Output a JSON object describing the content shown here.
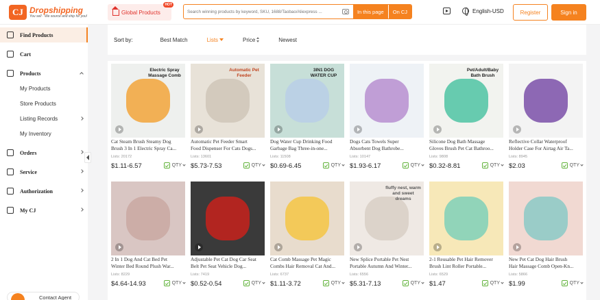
{
  "header": {
    "logo_mark": "CJ",
    "logo_name": "Dropshipping",
    "logo_tagline": "You sell · We source and ship for you!",
    "global_products": "Global Products",
    "hot_badge": "HOT",
    "search_placeholder": "Search winning products by keyword, SKU, 1688/Taobao/Aliexpress ...",
    "search_in_page": "In this page",
    "search_on_cj": "On CJ",
    "language": "English-USD",
    "register": "Register",
    "sign_in": "Sign in"
  },
  "sidebar": {
    "items": [
      {
        "label": "Find Products",
        "icon": "search-icon"
      },
      {
        "label": "Cart",
        "icon": "cart-icon"
      },
      {
        "label": "Products",
        "icon": "box-icon"
      },
      {
        "label": "Orders",
        "icon": "orders-icon"
      },
      {
        "label": "Service",
        "icon": "service-icon"
      },
      {
        "label": "Authorization",
        "icon": "authorization-icon"
      },
      {
        "label": "My CJ",
        "icon": "user-icon"
      }
    ],
    "products_sub": [
      "My Products",
      "Store Products",
      "Listing Records",
      "My Inventory"
    ],
    "contact_agent": "Contact Agent"
  },
  "sortbar": {
    "label": "Sort by:",
    "options": [
      "Best Match",
      "Lists",
      "Price",
      "Newest"
    ],
    "active": "Lists"
  },
  "products": [
    {
      "line1": "Cat Steam Brush Steamy Dog",
      "line2": "Brush 3 In 1 Electric Spray Ca...",
      "lists": "Lists: 20172",
      "price": "$1.11-6.57",
      "qty": "QTY",
      "bg": "#eef0ee",
      "accent": "#f2a43a",
      "overlay": "Electric Spray Massage Comb"
    },
    {
      "line1": "Automatic Pet Feeder Smart",
      "line2": "Food Dispenser For Cats Dogs...",
      "lists": "Lists: 13601",
      "price": "$5.73-7.53",
      "qty": "QTY",
      "bg": "#e8e2d8",
      "accent": "#cfc6b8",
      "overlay": "Automatic Pet Feeder"
    },
    {
      "line1": "Dog Water Cup Drinking Food",
      "line2": "Garbage Bag Three-in-one...",
      "lists": "Lists: 11508",
      "price": "$0.69-6.45",
      "qty": "QTY",
      "bg": "#c7dfd8",
      "accent": "#b9cfe8",
      "overlay": "3IN1 DOG WATER CUP"
    },
    {
      "line1": "Dogs Cats Towels Super",
      "line2": "Absorbent Dog Bathrobe...",
      "lists": "Lists: 10147",
      "price": "$1.93-6.17",
      "qty": "QTY",
      "bg": "#eef2f6",
      "accent": "#b78fd0",
      "overlay": ""
    },
    {
      "line1": "Silicone Dog Bath Massage",
      "line2": "Gloves Brush Pet Cat Bathroo...",
      "lists": "Lists: 9808",
      "price": "$0.32-8.81",
      "qty": "QTY",
      "bg": "#f2f3ef",
      "accent": "#4fc3a3",
      "overlay": "Pet/Adult/Baby Bath Brush"
    },
    {
      "line1": "Reflective Collar Waterproof",
      "line2": "Holder Case For Airtag Air Ta...",
      "lists": "Lists: 8945",
      "price": "$2.03",
      "qty": "QTY",
      "bg": "#f3f3f3",
      "accent": "#7a4fa8",
      "overlay": ""
    },
    {
      "line1": "2 In 1 Dog And Cat Bed Pet",
      "line2": "Winter Bed Round Plush War...",
      "lists": "Lists: 8229",
      "price": "$4.64-14.93",
      "qty": "QTY",
      "bg": "#d9c6c3",
      "accent": "#c9a8a2",
      "overlay": ""
    },
    {
      "line1": "Adjustable Pet Cat Dog Car Seat",
      "line2": "Belt Pet Seat Vehicle Dog...",
      "lists": "Lists: 7419",
      "price": "$0.52-0.54",
      "qty": "QTY",
      "bg": "#3a3a3a",
      "accent": "#c8221c",
      "overlay": ""
    },
    {
      "line1": "Cat Comb Massage Pet Magic",
      "line2": "Combs Hair Removal Cat And...",
      "lists": "Lists: 6737",
      "price": "$1.11-3.72",
      "qty": "QTY",
      "bg": "#e8dccd",
      "accent": "#f5c544",
      "overlay": ""
    },
    {
      "line1": "New Splice Portable Pet Nest",
      "line2": "Portable Autumn And Winter...",
      "lists": "Lists: 6556",
      "price": "$5.31-7.13",
      "qty": "QTY",
      "bg": "#efe9e4",
      "accent": "#d8cfc6",
      "overlay": "fluffy nest, warm and sweet dreams"
    },
    {
      "line1": "2-1 Reusable Pet Hair Remover",
      "line2": "Brush Lint Roller Portable...",
      "lists": "Lists: 6529",
      "price": "$1.47",
      "qty": "QTY",
      "bg": "#f7e8b8",
      "accent": "#7fd0b8",
      "overlay": ""
    },
    {
      "line1": "New Pet Cat Dog Hair Brush",
      "line2": "Hair Massage Comb Open-Kn...",
      "lists": "Lists: 5866",
      "price": "$1.99",
      "qty": "QTY",
      "bg": "#f1d9d2",
      "accent": "#8bc9c7",
      "overlay": ""
    }
  ]
}
